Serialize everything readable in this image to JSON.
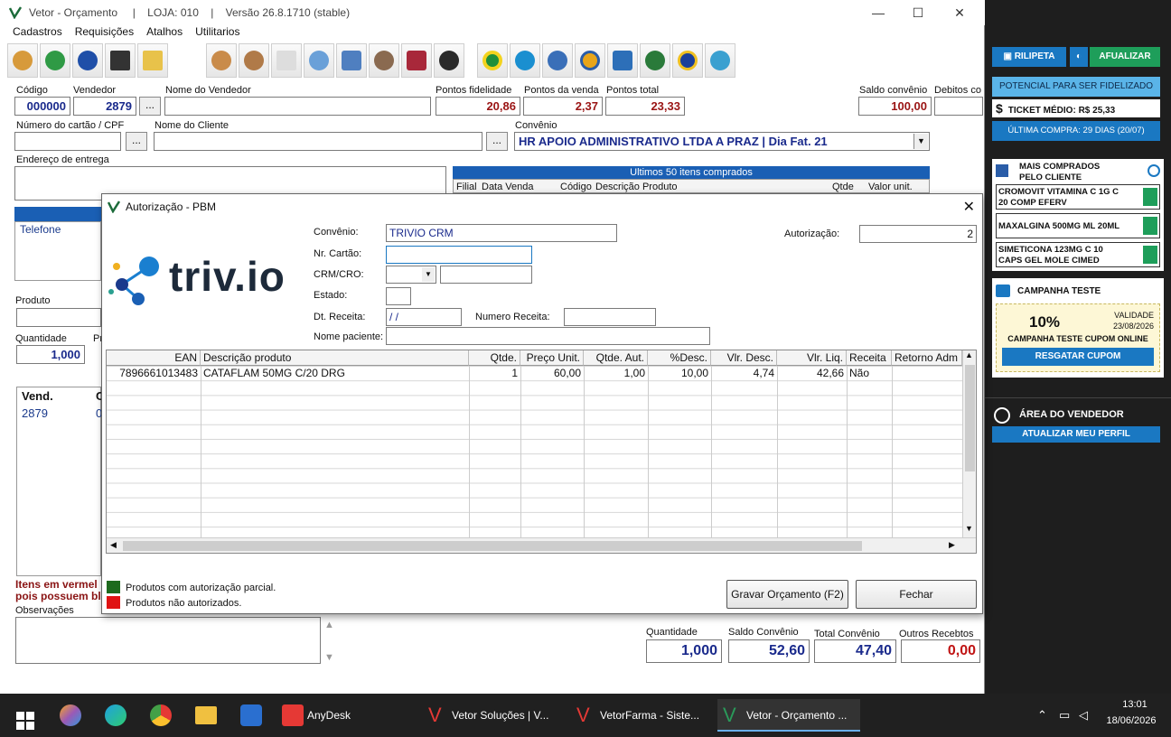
{
  "window": {
    "title": "Vetor - Orçamento     |    LOJA: 010    |    Versão 26.8.1710 (stable)"
  },
  "menu": [
    "Cadastros",
    "Requisições",
    "Atalhos",
    "Utilitarios"
  ],
  "form": {
    "codigo_label": "Código",
    "codigo_value": "000000",
    "vendedor_label": "Vendedor",
    "vendedor_value": "2879",
    "nome_vendedor_label": "Nome do Vendedor",
    "nome_vendedor_value": "",
    "pontos_fidelidade_label": "Pontos fidelidade",
    "pontos_fidelidade_value": "20,86",
    "pontos_venda_label": "Pontos da venda",
    "pontos_venda_value": "2,37",
    "pontos_total_label": "Pontos total",
    "pontos_total_value": "23,33",
    "saldo_convenio_label": "Saldo convênio",
    "saldo_convenio_value": "100,00",
    "debitos_label": "Debitos co",
    "cartao_label": "Número do cartão / CPF",
    "nome_cliente_label": "Nome do Cliente",
    "convenio_label": "Convênio",
    "convenio_value": "HR APOIO ADMINISTRATIVO LTDA A PRAZ | Dia Fat. 21",
    "endereco_label": "Endereço de entrega",
    "ultimos_header": "Ultimos 50 itens comprados",
    "ultimos_cols": [
      "Filial",
      "Data Venda",
      "Código",
      "Descrição Produto",
      "Qtde",
      "Valor unit."
    ],
    "telefone_label": "Telefone",
    "produto_label": "Produto",
    "quantidade_label": "Quantidade",
    "quantidade_value": "1,000",
    "pr_label": "Pr",
    "vend_col": "Vend.",
    "c_col": "C",
    "vend_row": "2879",
    "c_row": "0",
    "itens_warning_1": "Itens em vermel",
    "itens_warning_2": "pois possuem blo",
    "observacoes_label": "Observações"
  },
  "summary": {
    "quantidade_label": "Quantidade",
    "quantidade_value": "1,000",
    "saldo_label": "Saldo Convênio",
    "saldo_value": "52,60",
    "total_label": "Total Convênio",
    "total_value": "47,40",
    "outros_label": "Outros Recebtos",
    "outros_value": "0,00"
  },
  "side_panel": {
    "btn_ripilepta": "RILIPETA",
    "btn_atualizar": "AFUALIZAR",
    "potencial": "POTENCIAL PARA SER FIDELIZADO",
    "ticket": "TICKET MÉDIO: R$ 25,33",
    "ultima_compra": "ÚLTIMA COMPRA: 29 DIAS (20/07)",
    "mais_comprados_title_1": "MAIS COMPRADOS",
    "mais_comprados_title_2": "PELO CLIENTE",
    "items": [
      {
        "line1": "CROMOVIT VITAMINA C 1G C",
        "line2": "20 COMP EFERV"
      },
      {
        "line1": "MAXALGINA 500MG ML 20ML",
        "line2": ""
      },
      {
        "line1": "SIMETICONA 123MG C 10",
        "line2": "CAPS GEL MOLE CIMED"
      }
    ],
    "campanha_title": "CAMPANHA TESTE",
    "campanha_pct": "10%",
    "validade_label": "VALIDADE",
    "validade_date": "23/08/2026",
    "campanha_desc": "CAMPANHA TESTE CUPOM ONLINE",
    "resgatar": "RESGATAR CUPOM",
    "area_vendedor": "ÁREA DO VENDEDOR",
    "atualizar_perfil": "ATUALIZAR MEU PERFIL",
    "accent": "#1a78c2",
    "green": "#1e9e5a"
  },
  "dialog": {
    "title": "Autorização - PBM",
    "logo_text": "triv.io",
    "convenio_label": "Convênio:",
    "convenio_value": "TRIVIO CRM",
    "cartao_label": "Nr. Cartão:",
    "crm_label": "CRM/CRO:",
    "estado_label": "Estado:",
    "dt_receita_label": "Dt. Receita:",
    "dt_receita_value": "/ /",
    "numero_receita_label": "Numero Receita:",
    "nome_paciente_label": "Nome paciente:",
    "autorizacao_label": "Autorização:",
    "autorizacao_value": "2",
    "columns": [
      "EAN",
      "Descrição produto",
      "Qtde.",
      "Preço Unit.",
      "Qtde. Aut.",
      "%Desc.",
      "Vlr. Desc.",
      "Vlr. Liq.",
      "Receita",
      "Retorno Adm"
    ],
    "rows": [
      {
        "ean": "7896661013483",
        "descricao": "CATAFLAM 50MG C/20 DRG",
        "qtde": "1",
        "preco": "60,00",
        "qtde_aut": "1,00",
        "desc": "10,00",
        "vlr_desc": "4,74",
        "vlr_liq": "42,66",
        "receita": "Não",
        "retorno": ""
      }
    ],
    "legend_parcial": "Produtos com autorização parcial.",
    "legend_nao": "Produtos não autorizados.",
    "btn_gravar": "Gravar Orçamento (F2)",
    "btn_fechar": "Fechar"
  },
  "taskbar": {
    "anydesk": "AnyDesk",
    "vetor_solucoes": "Vetor Soluções | V...",
    "vetorfarma": "VetorFarma - Siste...",
    "vetor_orcamento": "Vetor - Orçamento ...",
    "time": "13:01",
    "date": "18/06/2026"
  }
}
